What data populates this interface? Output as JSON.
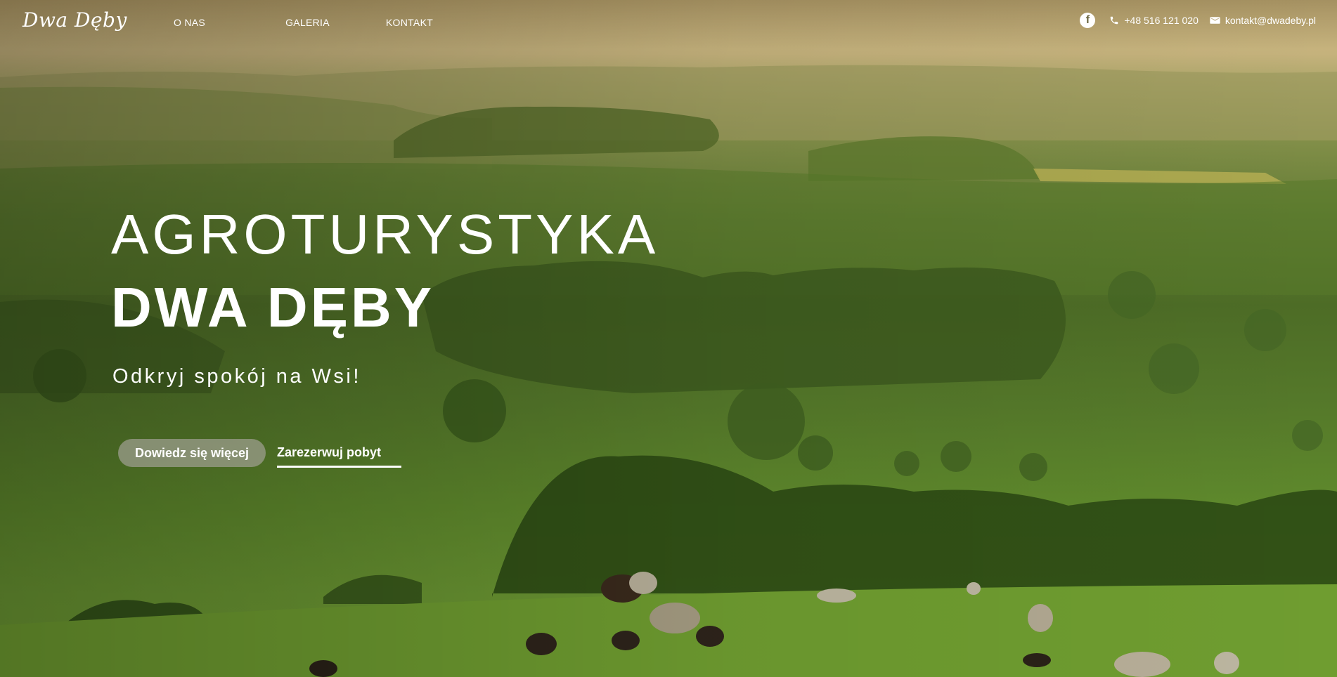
{
  "header": {
    "logo": "Dwa Dęby",
    "nav": [
      {
        "label": "O NAS"
      },
      {
        "label": "GALERIA"
      },
      {
        "label": "KONTAKT"
      }
    ],
    "contact": {
      "facebook_icon": "facebook-icon",
      "phone_icon": "phone-icon",
      "phone": "+48 516 121 020",
      "mail_icon": "mail-icon",
      "email": "kontakt@dwadeby.pl"
    }
  },
  "hero": {
    "title_line_1": "AGROTURYSTYKA",
    "title_line_2": "DWA DĘBY",
    "subtitle": "Odkryj spokój na Wsi!",
    "primary_button": "Dowiedz się więcej",
    "secondary_link": "Zarezerwuj pobyt"
  },
  "colors": {
    "text": "#ffffff",
    "button_bg": "#a0a091"
  }
}
